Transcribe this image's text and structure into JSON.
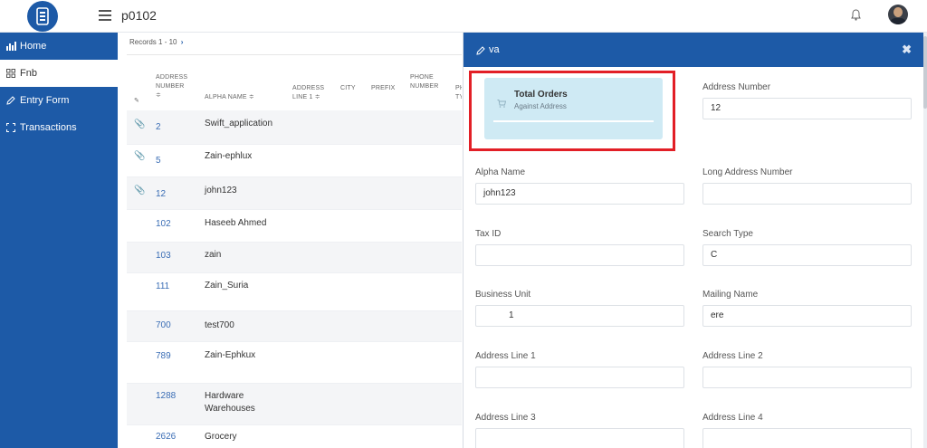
{
  "topbar": {
    "title": "p0102"
  },
  "sidebar": {
    "items": [
      {
        "label": "Home",
        "icon": "chart-icon"
      },
      {
        "label": "Fnb",
        "icon": "grid-icon"
      },
      {
        "label": "Entry Form",
        "icon": "pencil-icon"
      },
      {
        "label": "Transactions",
        "icon": "expand-icon"
      }
    ]
  },
  "table": {
    "records_label": "Records",
    "records_range": "1 - 10",
    "headers": [
      "ADDRESS",
      "NUMBER",
      "ALPHA NAME",
      "ADDRESS",
      "LINE 1",
      "CITY",
      "PREFIX",
      "PHONE",
      "NUMBER",
      "PH",
      "TY"
    ],
    "rows": [
      {
        "number": "2",
        "name": "Swift_application"
      },
      {
        "number": "5",
        "name": "Zain-ephlux"
      },
      {
        "number": "12",
        "name": "john123"
      },
      {
        "number": "102",
        "name": "Haseeb Ahmed"
      },
      {
        "number": "103",
        "name": "zain"
      },
      {
        "number": "111",
        "name": "Zain_Suria"
      },
      {
        "number": "700",
        "name": "test700"
      },
      {
        "number": "789",
        "name": "Zain-Ephkux"
      },
      {
        "number": "1288",
        "name": "Hardware",
        "name2": "Warehouses"
      },
      {
        "number": "2626",
        "name": "Grocery"
      }
    ]
  },
  "panel": {
    "title": "va",
    "card": {
      "title": "Total Orders",
      "subtitle": "Against Address"
    },
    "fields": {
      "address_number": {
        "label": "Address Number",
        "value": "12"
      },
      "alpha_name": {
        "label": "Alpha Name",
        "value": "john123"
      },
      "long_address_number": {
        "label": "Long Address Number",
        "value": ""
      },
      "tax_id": {
        "label": "Tax ID",
        "value": ""
      },
      "search_type": {
        "label": "Search Type",
        "value": "C"
      },
      "business_unit": {
        "label": "Business Unit",
        "value": "1"
      },
      "mailing_name": {
        "label": "Mailing Name",
        "value": "ere"
      },
      "address_line_1": {
        "label": "Address Line 1",
        "value": ""
      },
      "address_line_2": {
        "label": "Address Line 2",
        "value": ""
      },
      "address_line_3": {
        "label": "Address Line 3",
        "value": ""
      },
      "address_line_4": {
        "label": "Address Line 4",
        "value": ""
      }
    }
  },
  "colors": {
    "primary": "#1d5aa7",
    "highlight": "#e21f26",
    "card": "#cfeaf4"
  }
}
